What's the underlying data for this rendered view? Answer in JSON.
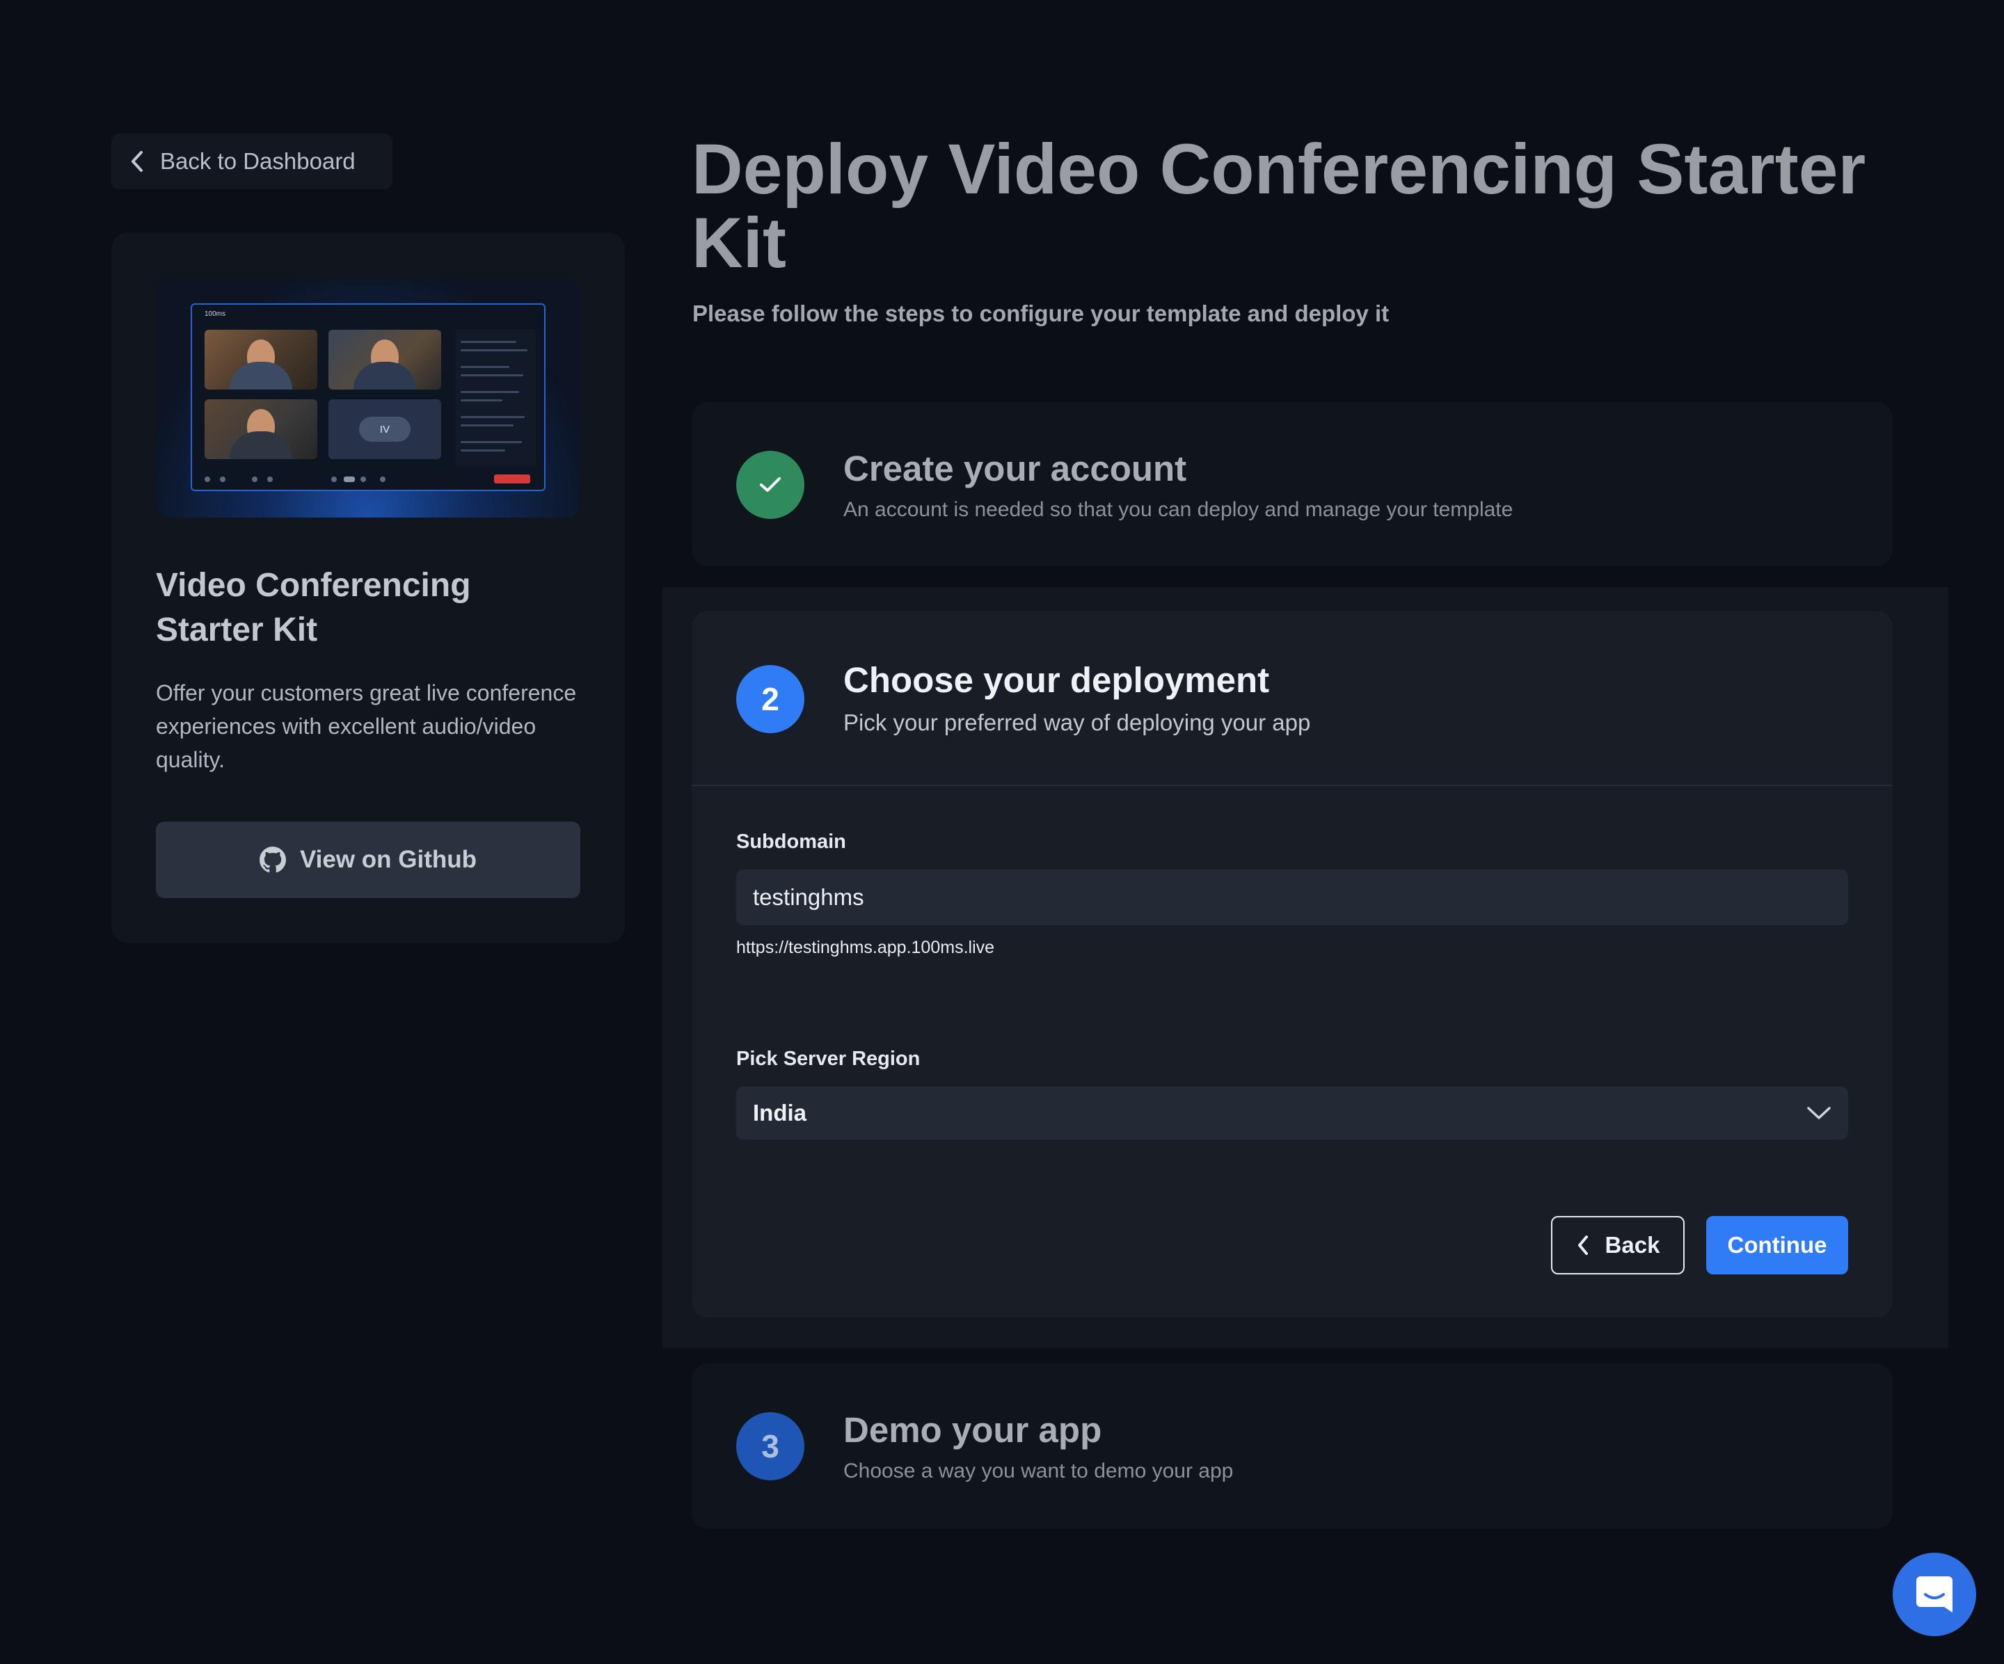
{
  "nav": {
    "back_to_dashboard": "Back to Dashboard"
  },
  "kit": {
    "title": "Video Conferencing Starter Kit",
    "description": "Offer your customers great live conference experiences with excellent audio/video quality.",
    "github_button": "View on Github",
    "preview": {
      "brand": "100ms",
      "avatar_initials": "IV"
    }
  },
  "page": {
    "title": "Deploy Video Conferencing Starter Kit",
    "subtitle": "Please follow the steps to configure your template and deploy it"
  },
  "steps": [
    {
      "status": "complete",
      "title": "Create your account",
      "description": "An account is needed so that you can deploy and manage your template"
    },
    {
      "status": "active",
      "number": "2",
      "title": "Choose your deployment",
      "description": "Pick your preferred way of deploying your app"
    },
    {
      "status": "upcoming",
      "number": "3",
      "title": "Demo your app",
      "description": "Choose a way you want to demo your app"
    }
  ],
  "deployment_form": {
    "subdomain_label": "Subdomain",
    "subdomain_value": "testinghms",
    "subdomain_url": "https://testinghms.app.100ms.live",
    "region_label": "Pick Server Region",
    "region_value": "India",
    "back_button": "Back",
    "continue_button": "Continue"
  },
  "colors": {
    "background": "#0b0e14",
    "accent": "#2f7cf6",
    "success": "#2f8a5d",
    "step3_badge": "#1f56b5",
    "chat_fab": "#2e6fe6"
  },
  "icons": {
    "back": "chevron-left-icon",
    "github": "github-icon",
    "complete": "check-icon",
    "select": "chevron-down-icon",
    "chat": "chat-icon"
  }
}
